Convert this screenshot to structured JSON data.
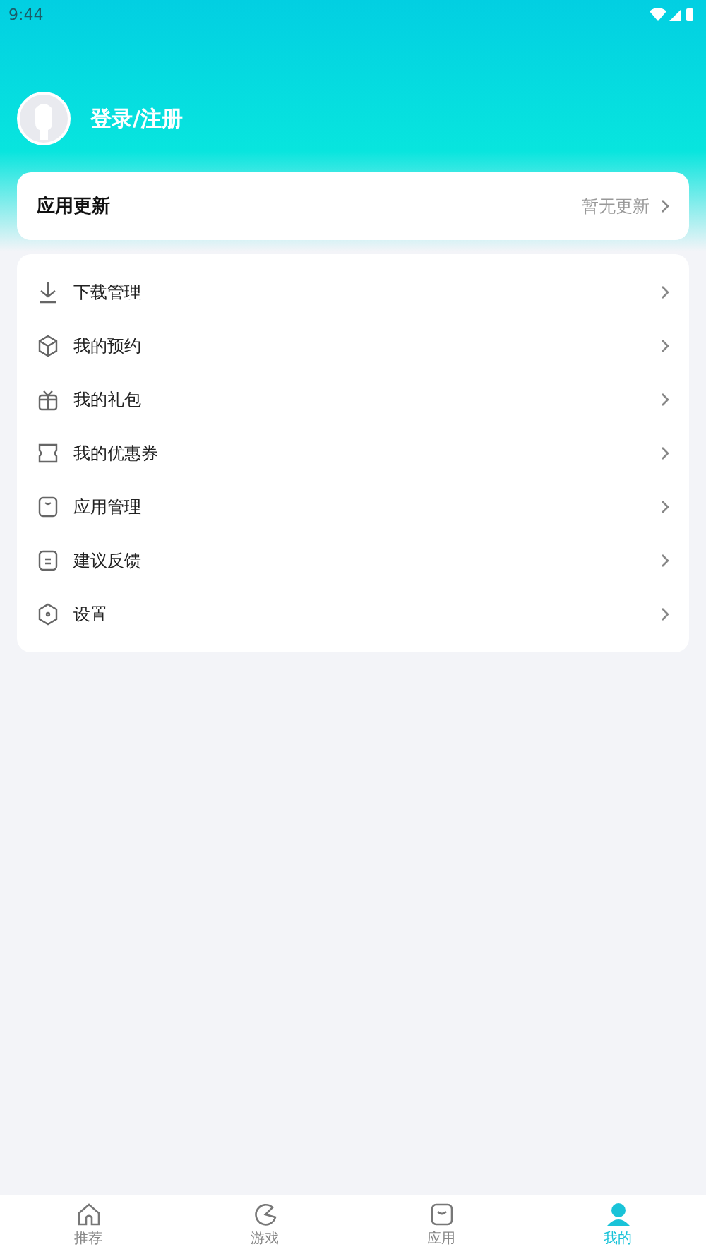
{
  "status_bar": {
    "time": "9:44"
  },
  "profile": {
    "name": "登录/注册"
  },
  "update_card": {
    "title": "应用更新",
    "status": "暂无更新"
  },
  "menu": [
    {
      "kind": "download",
      "label": "下载管理"
    },
    {
      "kind": "box",
      "label": "我的预约"
    },
    {
      "kind": "gift",
      "label": "我的礼包"
    },
    {
      "kind": "ticket",
      "label": "我的优惠券"
    },
    {
      "kind": "app",
      "label": "应用管理"
    },
    {
      "kind": "feedback",
      "label": "建议反馈"
    },
    {
      "kind": "settings",
      "label": "设置"
    }
  ],
  "bottom_nav": [
    {
      "kind": "home",
      "label": "推荐",
      "selected": false
    },
    {
      "kind": "game",
      "label": "游戏",
      "selected": false
    },
    {
      "kind": "bag",
      "label": "应用",
      "selected": false
    },
    {
      "kind": "me",
      "label": "我的",
      "selected": true
    }
  ]
}
